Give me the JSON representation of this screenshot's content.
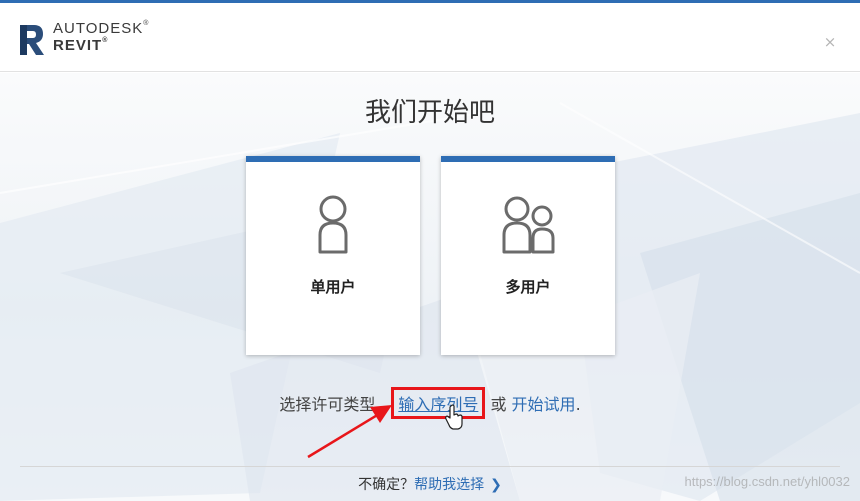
{
  "header": {
    "brand_line1": "AUTODESK",
    "brand_line2": "REVIT",
    "close_label": "×"
  },
  "main": {
    "title": "我们开始吧",
    "cards": [
      {
        "label": "单用户",
        "icon": "single-user-icon"
      },
      {
        "label": "多用户",
        "icon": "multi-user-icon"
      }
    ],
    "license_prompt": "选择许可类型，",
    "serial_link": "输入序列号",
    "or_text": " 或 ",
    "trial_link": "开始试用",
    "period": "."
  },
  "footer": {
    "unsure_text": "不确定？",
    "help_link": "帮助我选择",
    "chevron": "❯"
  },
  "watermark": "https://blog.csdn.net/yhl0032",
  "colors": {
    "accent": "#2e6db4",
    "highlight_box": "#e8161a",
    "logo": "#2b4d7a"
  }
}
